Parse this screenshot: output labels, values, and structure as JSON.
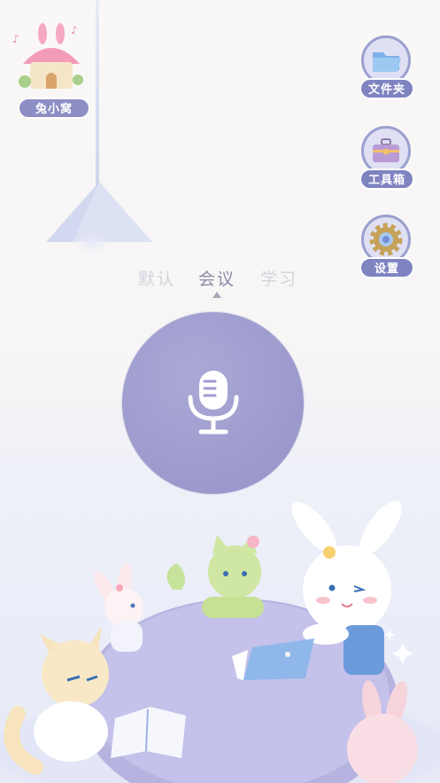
{
  "home": {
    "label": "兔小窝",
    "icon": "bunny-house-icon"
  },
  "tools": [
    {
      "label": "文件夹",
      "icon": "folder-icon"
    },
    {
      "label": "工具箱",
      "icon": "toolbox-icon"
    },
    {
      "label": "设置",
      "icon": "gear-icon"
    }
  ],
  "tabs": [
    {
      "label": "默认",
      "active": false
    },
    {
      "label": "会议",
      "active": true
    },
    {
      "label": "学习",
      "active": false
    }
  ],
  "record": {
    "icon": "microphone-icon"
  },
  "colors": {
    "accent": "#9f9dcf",
    "badge": "#7f84c1",
    "background": "#f7f5f5"
  }
}
